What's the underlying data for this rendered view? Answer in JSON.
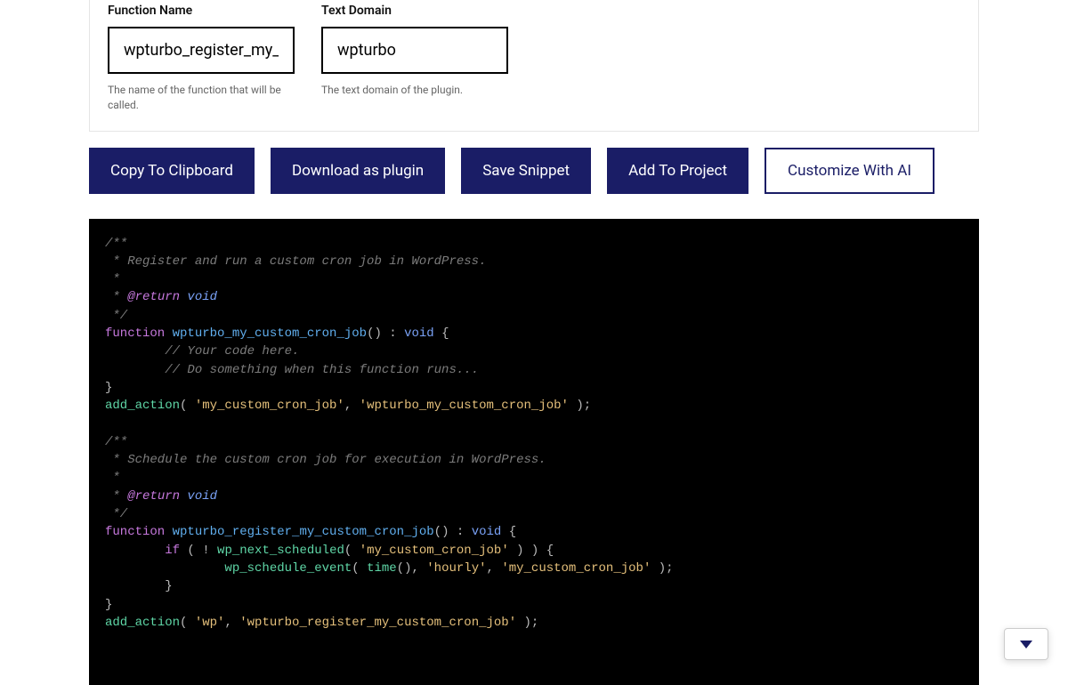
{
  "form": {
    "function_name": {
      "label": "Function Name",
      "value": "wpturbo_register_my_c",
      "helper": "The name of the function that will be called."
    },
    "text_domain": {
      "label": "Text Domain",
      "value": "wpturbo",
      "helper": "The text domain of the plugin."
    }
  },
  "buttons": {
    "copy": "Copy To Clipboard",
    "download": "Download as plugin",
    "save": "Save Snippet",
    "add": "Add To Project",
    "customize": "Customize With AI"
  },
  "code": {
    "block1": {
      "doc1": "/**",
      "doc2": " * Register and run a custom cron job in WordPress.",
      "doc3": " *",
      "doc4_pre": " * ",
      "doc4_tag": "@return",
      "doc4_type": " void",
      "doc5": " */",
      "fn_kw": "function",
      "fn_name": " wpturbo_my_custom_cron_job",
      "fn_sig_open": "() : ",
      "fn_ret": "void",
      "fn_brace": " {",
      "line1": "        // Your code here.",
      "line2": "        // Do something when this function runs...",
      "close": "}",
      "add_call": "add_action",
      "add_open": "( ",
      "add_arg1": "'my_custom_cron_job'",
      "add_sep": ", ",
      "add_arg2": "'wpturbo_my_custom_cron_job'",
      "add_close": " );"
    },
    "block2": {
      "doc1": "/**",
      "doc2": " * Schedule the custom cron job for execution in WordPress.",
      "doc3": " *",
      "doc4_pre": " * ",
      "doc4_tag": "@return",
      "doc4_type": " void",
      "doc5": " */",
      "fn_kw": "function",
      "fn_name": " wpturbo_register_my_custom_cron_job",
      "fn_sig_open": "() : ",
      "fn_ret": "void",
      "fn_brace": " {",
      "if_indent": "        ",
      "if_kw": "if",
      "if_open": " ( ! ",
      "if_call": "wp_next_scheduled",
      "if_call_open": "( ",
      "if_arg": "'my_custom_cron_job'",
      "if_call_close": " ) ) {",
      "sched_indent": "                ",
      "sched_call": "wp_schedule_event",
      "sched_open": "( ",
      "sched_time": "time",
      "sched_time_p": "(), ",
      "sched_arg2": "'hourly'",
      "sched_sep": ", ",
      "sched_arg3": "'my_custom_cron_job'",
      "sched_close": " );",
      "if_close": "        }",
      "fn_close": "}",
      "add_call": "add_action",
      "add_open": "( ",
      "add_arg1": "'wp'",
      "add_sep": ", ",
      "add_arg2": "'wpturbo_register_my_custom_cron_job'",
      "add_close": " );"
    }
  }
}
